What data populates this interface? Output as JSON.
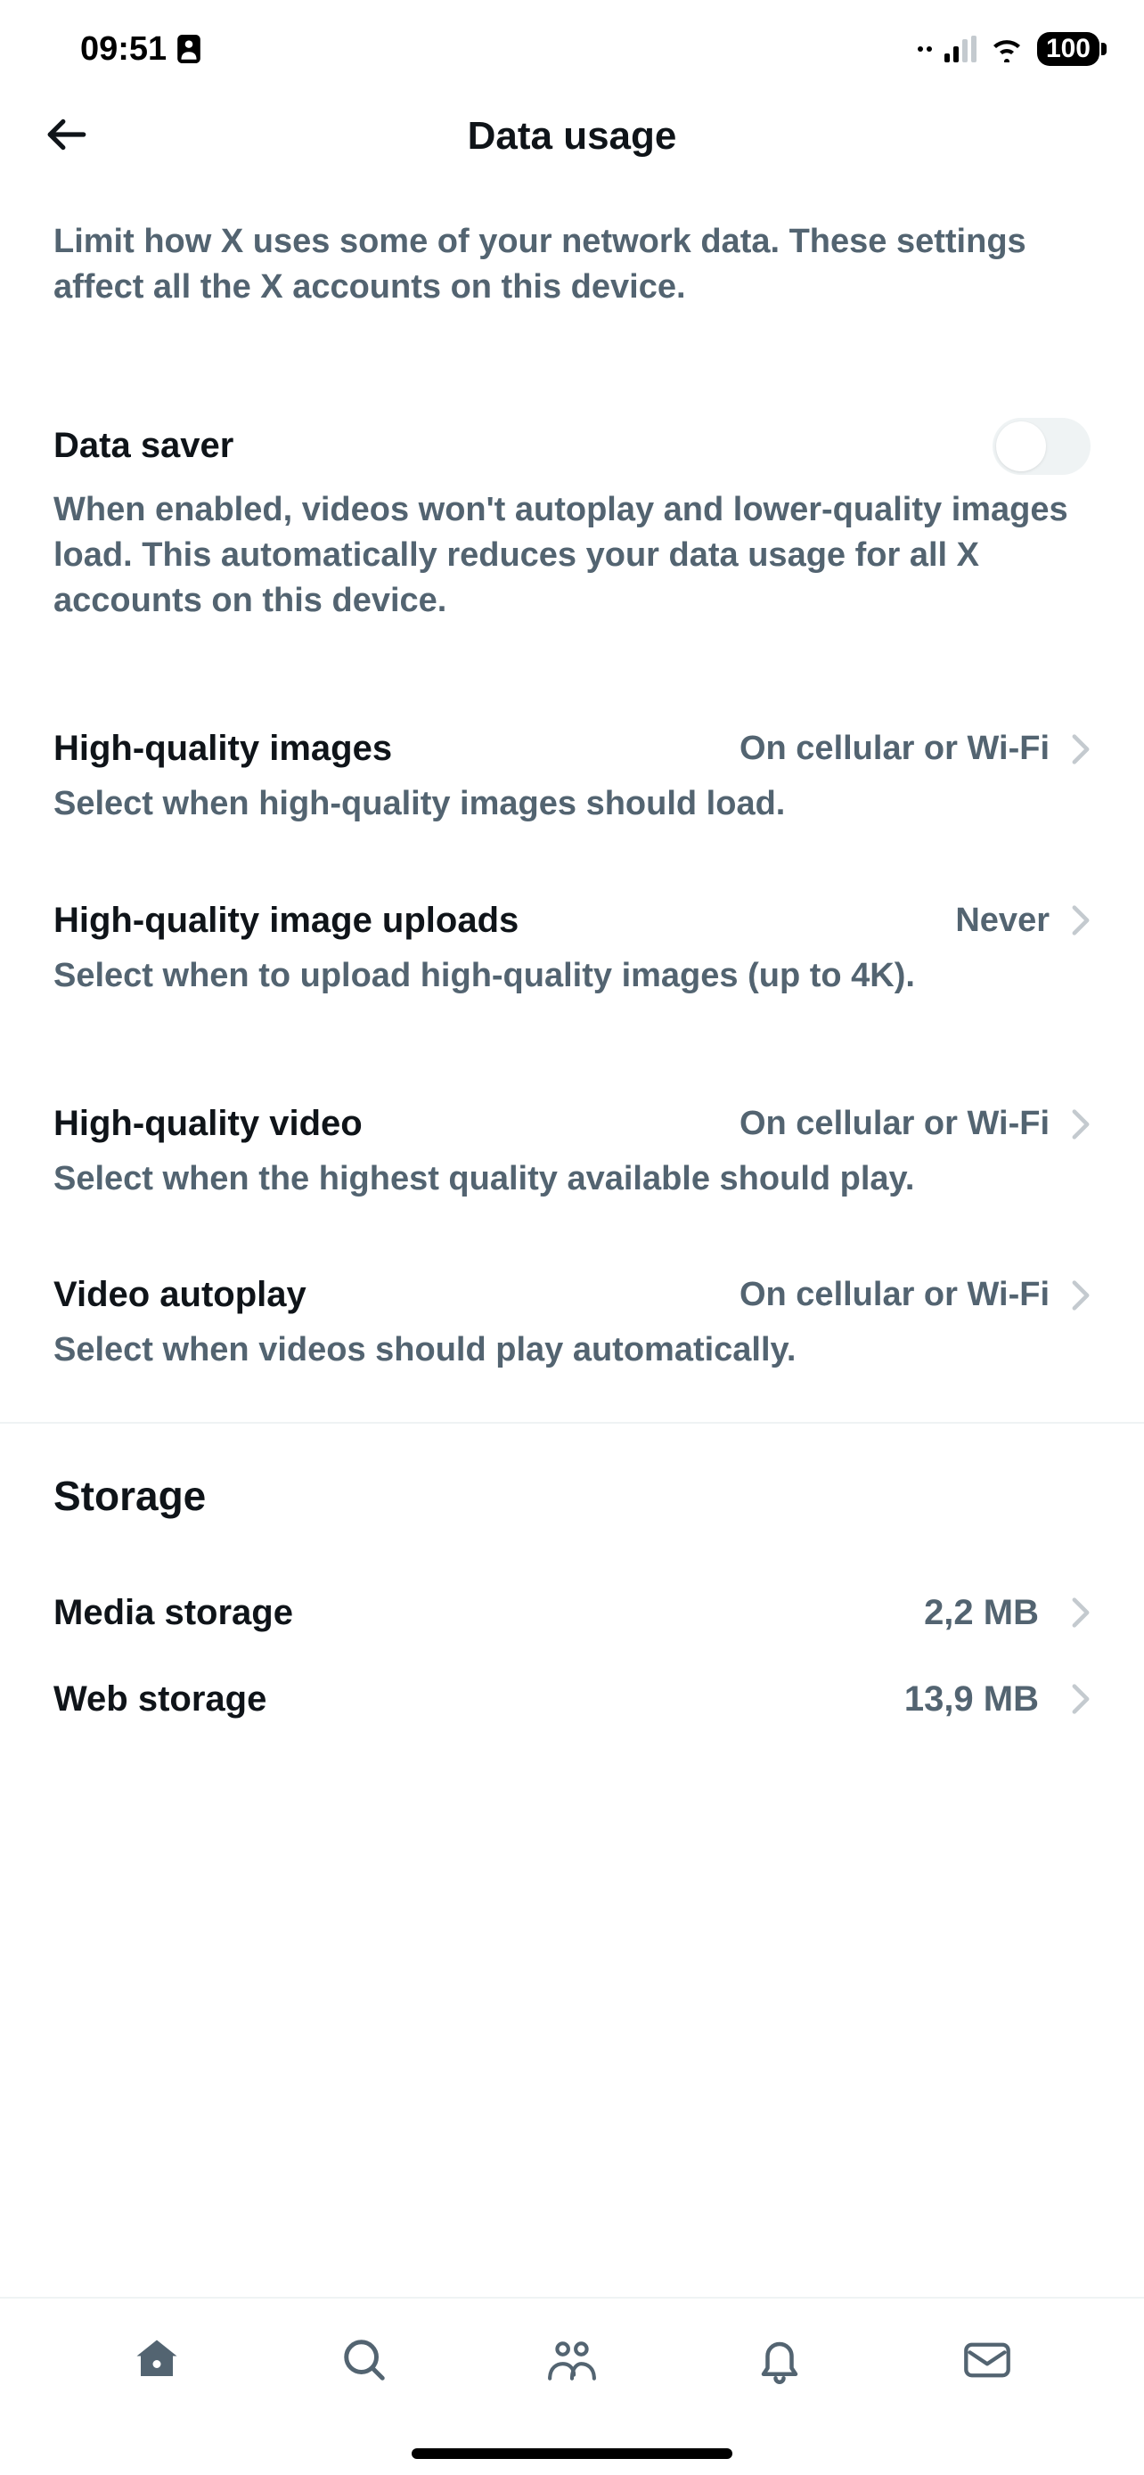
{
  "status_bar": {
    "time": "09:51",
    "battery": "100"
  },
  "header": {
    "title": "Data usage"
  },
  "intro": "Limit how X uses some of your network data. These settings affect all the X accounts on this device.",
  "data_saver": {
    "title": "Data saver",
    "enabled": false,
    "desc": "When enabled, videos won't autoplay and lower-quality images load. This automatically reduces your data usage for all X accounts on this device."
  },
  "settings": {
    "hq_images": {
      "title": "High-quality images",
      "value": "On cellular or Wi-Fi",
      "desc": "Select when high-quality images should load."
    },
    "hq_uploads": {
      "title": "High-quality image uploads",
      "value": "Never",
      "desc": "Select when to upload high-quality images (up to 4K)."
    },
    "hq_video": {
      "title": "High-quality video",
      "value": "On cellular or Wi-Fi",
      "desc": "Select when the highest quality available should play."
    },
    "autoplay": {
      "title": "Video autoplay",
      "value": "On cellular or Wi-Fi",
      "desc": "Select when videos should play automatically."
    }
  },
  "storage": {
    "heading": "Storage",
    "media": {
      "title": "Media storage",
      "value": "2,2 MB"
    },
    "web": {
      "title": "Web storage",
      "value": "13,9 MB"
    }
  }
}
